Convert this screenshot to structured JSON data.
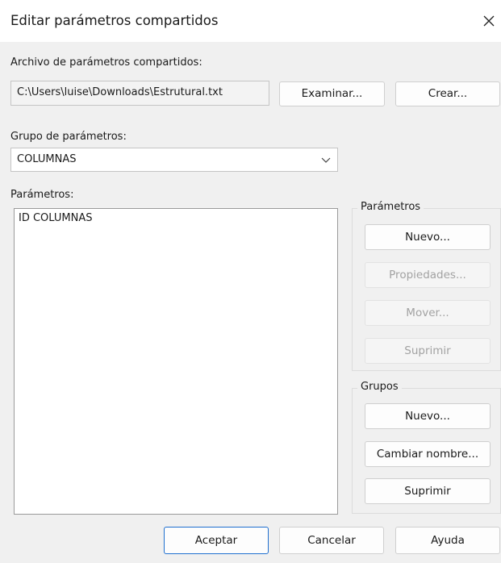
{
  "window": {
    "title": "Editar parámetros compartidos",
    "close_icon": "close-icon"
  },
  "file": {
    "label": "Archivo de parámetros compartidos:",
    "value": "C:\\Users\\luise\\Downloads\\Estrutural.txt",
    "browse_label": "Examinar...",
    "create_label": "Crear..."
  },
  "group": {
    "label": "Grupo de parámetros:",
    "selected": "COLUMNAS"
  },
  "parameters": {
    "label": "Parámetros:",
    "items": [
      "ID COLUMNAS"
    ]
  },
  "param_actions": {
    "legend": "Parámetros",
    "new_label": "Nuevo...",
    "properties_label": "Propiedades...",
    "move_label": "Mover...",
    "delete_label": "Suprimir"
  },
  "group_actions": {
    "legend": "Grupos",
    "new_label": "Nuevo...",
    "rename_label": "Cambiar nombre...",
    "delete_label": "Suprimir"
  },
  "footer": {
    "ok_label": "Aceptar",
    "cancel_label": "Cancelar",
    "help_label": "Ayuda"
  },
  "colors": {
    "accent": "#1f6fcf",
    "background": "#f0f0f0"
  }
}
